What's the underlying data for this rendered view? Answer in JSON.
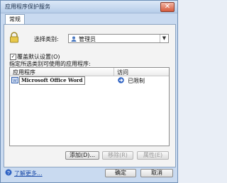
{
  "window": {
    "title": "应用程序保护服务",
    "close_glyph": "✕"
  },
  "tabs": [
    {
      "label": "常规"
    }
  ],
  "general": {
    "category_label": "选择类别:",
    "category_value": "管理员",
    "override_label": "覆盖默认设置(O)",
    "override_checked": true,
    "allowed_apps_label": "指定所选类别可使用的应用程序:"
  },
  "table": {
    "columns": [
      "应用程序",
      "访问"
    ],
    "rows": [
      {
        "application": "Microsoft Office Word",
        "access": "已限制"
      }
    ]
  },
  "buttons": {
    "add": "添加(D)...",
    "remove": "移除(R)",
    "properties": "属性(E)",
    "ok": "确定",
    "cancel": "取消"
  },
  "help_link": "了解更多..."
}
